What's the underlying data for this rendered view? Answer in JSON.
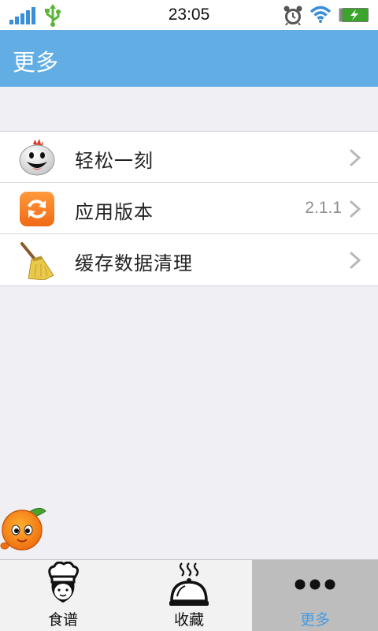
{
  "status_bar": {
    "time": "23:05",
    "icons": [
      "signal-icon",
      "usb-icon",
      "alarm-icon",
      "wifi-icon",
      "battery-charging-icon"
    ]
  },
  "header": {
    "title": "更多",
    "color": "#62aee4"
  },
  "menu": {
    "items": [
      {
        "label": "轻松一刻",
        "value": "",
        "icon": "smiley-mascot-icon"
      },
      {
        "label": "应用版本",
        "value": "2.1.1",
        "icon": "refresh-icon"
      },
      {
        "label": "缓存数据清理",
        "value": "",
        "icon": "broom-icon"
      }
    ]
  },
  "tab_bar": {
    "tabs": [
      {
        "label": "食谱",
        "icon": "chef-icon",
        "active": false
      },
      {
        "label": "收藏",
        "icon": "cloche-icon",
        "active": false
      },
      {
        "label": "更多",
        "icon": "more-dots-icon",
        "active": true
      }
    ],
    "active_color": "#4a9be0"
  },
  "mascot": {
    "icon": "orange-mascot-icon"
  }
}
